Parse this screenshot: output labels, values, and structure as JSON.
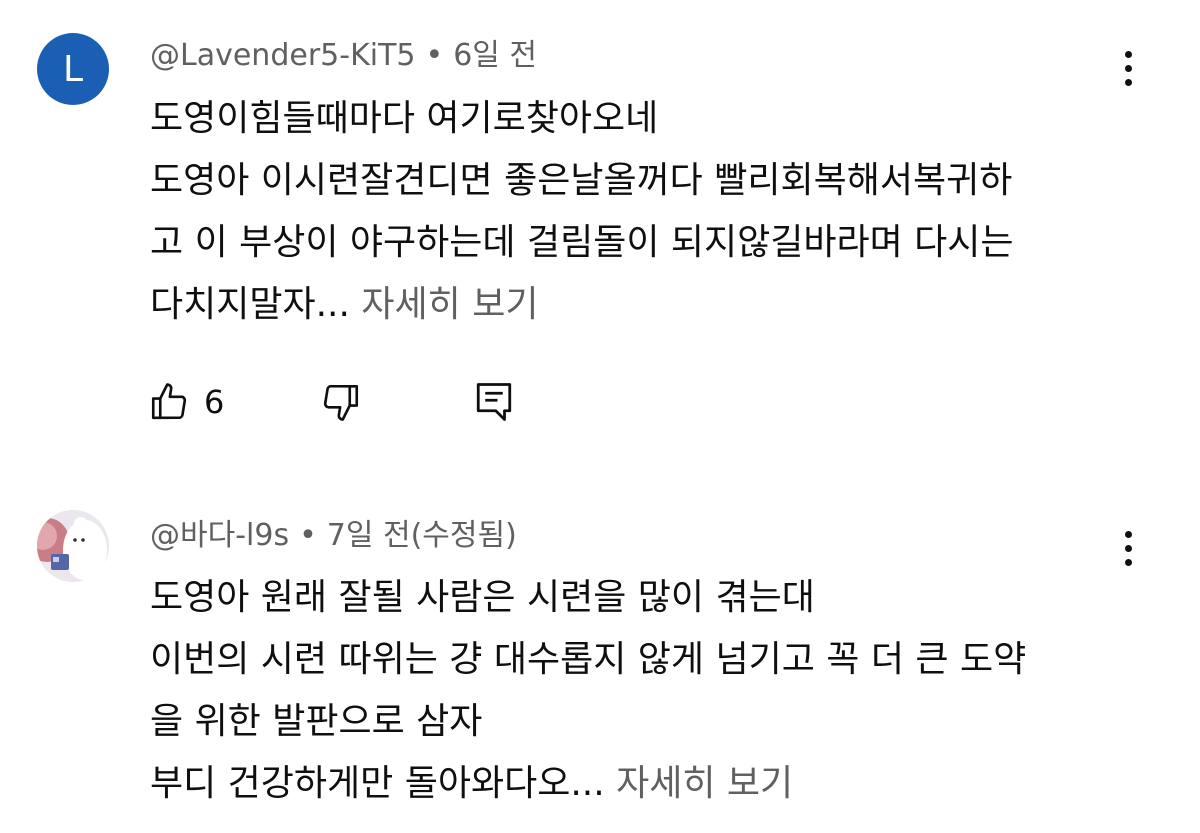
{
  "comments": [
    {
      "avatar_letter": "L",
      "avatar_color": "#1a5fb4",
      "author": "@Lavender5-KiT5",
      "separator": "•",
      "time": "6일 전",
      "lines": [
        "도영이힘들때마다 여기로찾아오네",
        "도영아 이시련잘견디면 좋은날올꺼다 빨리회복해서복귀하",
        "고 이 부상이 야구하는데 걸림돌이 되지않길바라며 다시는",
        "다치지말자..."
      ],
      "read_more": "자세히 보기",
      "like_count": "6",
      "icons": {
        "like": "thumbs-up-icon",
        "dislike": "thumbs-down-icon",
        "reply": "reply-comment-icon",
        "menu": "more-vertical-icon"
      }
    },
    {
      "author": "@바다-l9s",
      "separator": "•",
      "time": "7일 전(수정됨)",
      "lines": [
        "도영아 원래 잘될 사람은 시련을 많이 겪는대",
        "이번의 시련 따위는 걍 대수롭지 않게 넘기고 꼭 더 큰 도약",
        "을 위한 발판으로 삼자",
        "부디 건강하게만 돌아와다오..."
      ],
      "read_more": "자세히 보기",
      "icons": {
        "menu": "more-vertical-icon"
      }
    }
  ]
}
